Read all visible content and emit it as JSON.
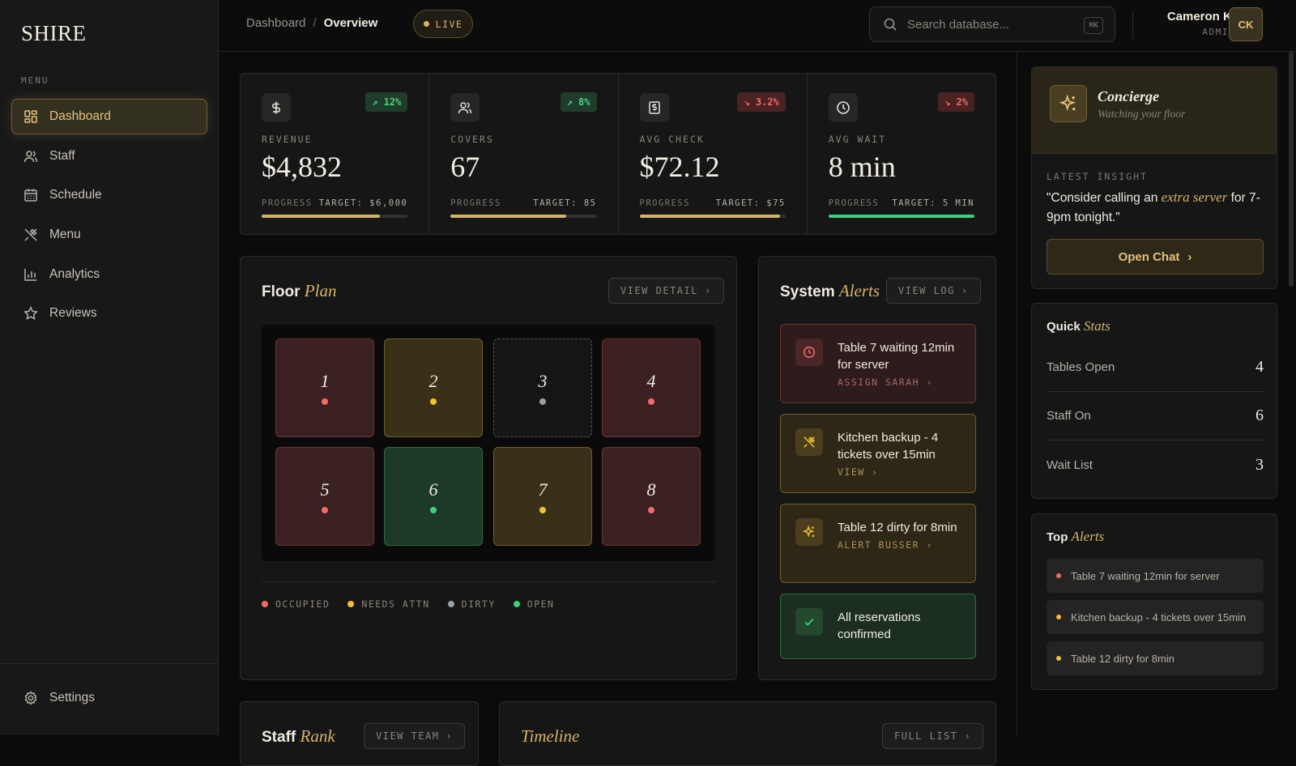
{
  "brand": "SHIRE",
  "sidebar": {
    "menu_label": "MENU",
    "items": [
      {
        "label": "Dashboard",
        "icon": "grid-icon",
        "active": true
      },
      {
        "label": "Staff",
        "icon": "users-icon"
      },
      {
        "label": "Schedule",
        "icon": "calendar-icon"
      },
      {
        "label": "Menu",
        "icon": "utensils-icon"
      },
      {
        "label": "Analytics",
        "icon": "bar-chart-icon"
      },
      {
        "label": "Reviews",
        "icon": "star-icon"
      }
    ],
    "settings_label": "Settings"
  },
  "topbar": {
    "crumb_root": "Dashboard",
    "crumb_sep": "/",
    "crumb_current": "Overview",
    "live": "LIVE",
    "search_placeholder": "Search database...",
    "shortcut": "⌘K",
    "user_name": "Cameron K.",
    "user_role": "ADMIN",
    "avatar": "CK"
  },
  "stats": [
    {
      "label": "REVENUE",
      "value": "$4,832",
      "delta": "12%",
      "trend": "up",
      "progress_label": "PROGRESS",
      "target": "TARGET: $6,000",
      "progress": 0.81
    },
    {
      "label": "COVERS",
      "value": "67",
      "delta": "8%",
      "trend": "up",
      "progress_label": "PROGRESS",
      "target": "TARGET: 85",
      "progress": 0.79
    },
    {
      "label": "AVG CHECK",
      "value": "$72.12",
      "delta": "3.2%",
      "trend": "down",
      "progress_label": "PROGRESS",
      "target": "TARGET: $75",
      "progress": 0.96
    },
    {
      "label": "AVG WAIT",
      "value": "8 min",
      "delta": "2%",
      "trend": "down",
      "progress_label": "PROGRESS",
      "target": "TARGET: 5 MIN",
      "progress": 1.0
    }
  ],
  "floor": {
    "title": "Floor",
    "title_accent": "Plan",
    "button": "VIEW DETAIL",
    "tables": [
      {
        "num": "1",
        "status": "occ"
      },
      {
        "num": "2",
        "status": "att"
      },
      {
        "num": "3",
        "status": "dirty"
      },
      {
        "num": "4",
        "status": "occ"
      },
      {
        "num": "5",
        "status": "occ"
      },
      {
        "num": "6",
        "status": "open"
      },
      {
        "num": "7",
        "status": "att"
      },
      {
        "num": "8",
        "status": "occ"
      }
    ],
    "legend": [
      "OCCUPIED",
      "NEEDS ATTN",
      "DIRTY",
      "OPEN"
    ]
  },
  "alerts": {
    "title": "System",
    "title_accent": "Alerts",
    "button": "VIEW LOG",
    "items": [
      {
        "text": "Table 7 waiting 12min for server",
        "action": "ASSIGN SARAH ›",
        "tone": "red",
        "icon": "clock-icon"
      },
      {
        "text": "Kitchen backup - 4 tickets over 15min",
        "action": "VIEW ›",
        "tone": "yel",
        "icon": "utensils-icon"
      },
      {
        "text": "Table 12 dirty for 8min",
        "action": "ALERT BUSSER ›",
        "tone": "yel",
        "icon": "sparkle-icon"
      },
      {
        "text": "All reservations confirmed",
        "action": "",
        "tone": "grn",
        "icon": "check-icon"
      }
    ]
  },
  "staff_panel": {
    "title": "Staff",
    "title_accent": "Rank",
    "button": "VIEW TEAM"
  },
  "timeline_panel": {
    "title_accent": "Timeline",
    "button": "FULL LIST"
  },
  "concierge": {
    "title": "Concierge",
    "subtitle": "Watching your floor",
    "insight_label": "LATEST INSIGHT",
    "insight_pre": "\"Consider calling an ",
    "insight_em": "extra server",
    "insight_post": " for 7-9pm tonight.\"",
    "button": "Open Chat"
  },
  "quick_stats": {
    "title": "Quick",
    "title_accent": "Stats",
    "rows": [
      {
        "label": "Tables Open",
        "value": "4"
      },
      {
        "label": "Staff On",
        "value": "6"
      },
      {
        "label": "Wait List",
        "value": "3"
      }
    ]
  },
  "top_alerts": {
    "title": "Top",
    "title_accent": "Alerts",
    "items": [
      {
        "text": "Table 7 waiting 12min for server",
        "color": "#f26b6b"
      },
      {
        "text": "Kitchen backup - 4 tickets over 15min",
        "color": "#f2c230"
      },
      {
        "text": "Table 12 dirty for 8min",
        "color": "#f2c230"
      }
    ]
  },
  "colors": {
    "accent": "#d8b469",
    "occupied": "#f26b6b",
    "attention": "#f2c230",
    "dirty": "#9aa0a8",
    "open": "#3ad27a"
  }
}
